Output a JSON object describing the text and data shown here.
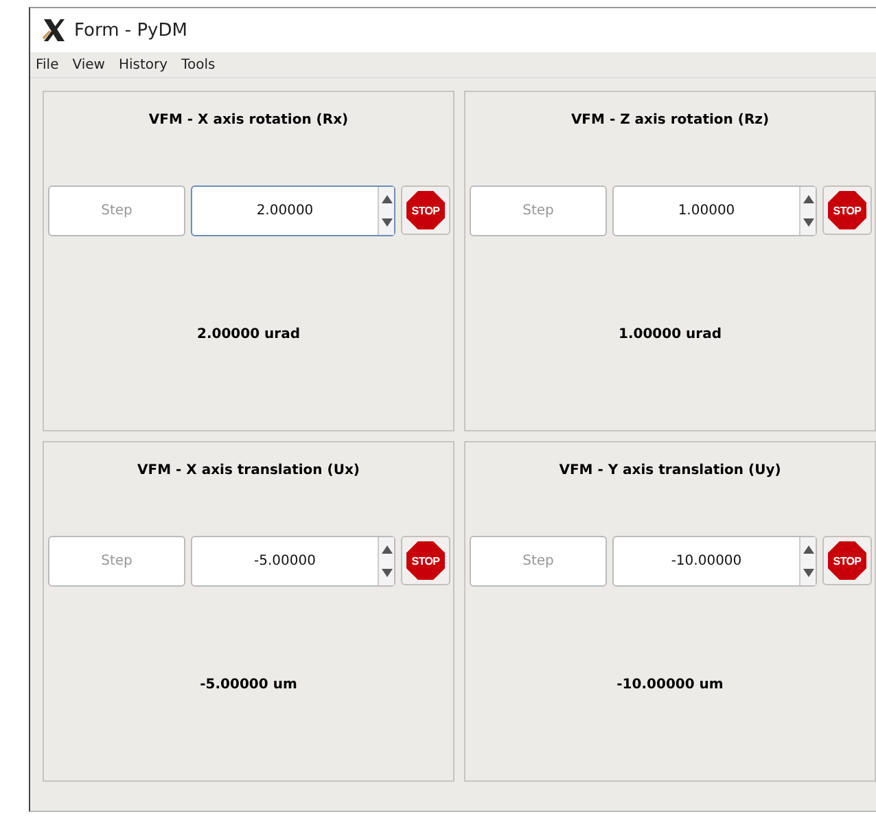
{
  "window": {
    "title": "Form - PyDM"
  },
  "menu": [
    "File",
    "View",
    "History",
    "Tools"
  ],
  "panels": [
    {
      "title": "VFM - X axis rotation (Rx)",
      "step_placeholder": "Step",
      "value": "2.00000",
      "focused": true,
      "stop": "STOP",
      "reading": "2.00000 urad"
    },
    {
      "title": "VFM - Z axis rotation (Rz)",
      "step_placeholder": "Step",
      "value": "1.00000",
      "focused": false,
      "stop": "STOP",
      "reading": "1.00000 urad"
    },
    {
      "title": "VFM - X axis translation (Ux)",
      "step_placeholder": "Step",
      "value": "-5.00000",
      "focused": false,
      "stop": "STOP",
      "reading": "-5.00000 um"
    },
    {
      "title": "VFM - Y axis translation (Uy)",
      "step_placeholder": "Step",
      "value": "-10.00000",
      "focused": false,
      "stop": "STOP",
      "reading": "-10.00000 um"
    }
  ]
}
